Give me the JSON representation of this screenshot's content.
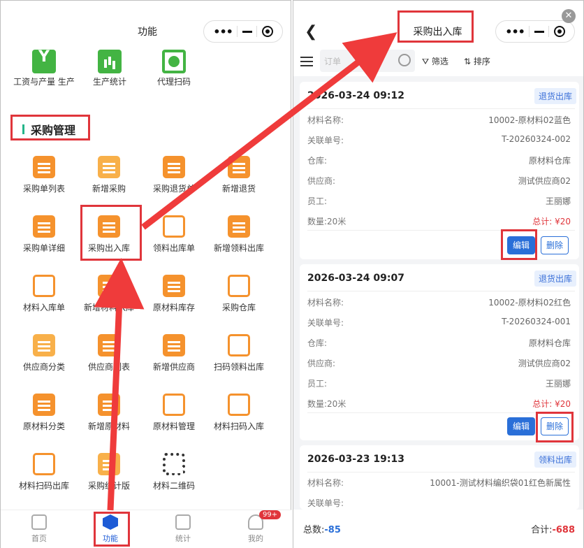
{
  "left": {
    "nav_title": "功能",
    "top_items": [
      {
        "label": "工资与产量 生产",
        "icon": "y-icon"
      },
      {
        "label": "生产统计",
        "icon": "chart-icon"
      },
      {
        "label": "代理扫码",
        "icon": "scan-icon"
      }
    ],
    "section_title": "采购管理",
    "grid": [
      "采购单列表",
      "新增采购",
      "采购退货单",
      "新增退货",
      "采购单详细",
      "采购出入库",
      "领料出库单",
      "新增领料出库",
      "材料入库单",
      "新增材料入库",
      "原材料库存",
      "采购仓库",
      "供应商分类",
      "供应商列表",
      "新增供应商",
      "扫码领料出库",
      "原材料分类",
      "新增原材料",
      "原材料管理",
      "材料扫码入库",
      "材料扫码出库",
      "采购统计版",
      "材料二维码"
    ],
    "tabs": [
      {
        "label": "首页"
      },
      {
        "label": "功能"
      },
      {
        "label": "统计"
      },
      {
        "label": "我的"
      }
    ],
    "badge": "99+"
  },
  "right": {
    "title": "采购出入库",
    "search_placeholder": "订单",
    "filter_label": "筛选",
    "sort_label": "排序",
    "field_labels": {
      "material": "材料名称:",
      "order": "关联单号:",
      "warehouse": "仓库:",
      "supplier": "供应商:",
      "staff": "员工:"
    },
    "cards": [
      {
        "time": "2026-03-24 09:12",
        "tag": "退货出库",
        "material": "10002-原材料02蓝色",
        "order": "T-20260324-002",
        "warehouse": "原材料仓库",
        "supplier": "测试供应商02",
        "staff": "王丽娜",
        "qty": "数量:20米",
        "total": "总计: ¥20",
        "edit": "编辑",
        "del": "删除"
      },
      {
        "time": "2026-03-24 09:07",
        "tag": "退货出库",
        "material": "10002-原材料02红色",
        "order": "T-20260324-001",
        "warehouse": "原材料仓库",
        "supplier": "测试供应商02",
        "staff": "王丽娜",
        "qty": "数量:20米",
        "total": "总计: ¥20",
        "edit": "编辑",
        "del": "删除"
      },
      {
        "time": "2026-03-23 19:13",
        "tag": "领料出库",
        "material": "10001-测试材料编织袋01红色新属性",
        "order": ""
      }
    ],
    "footer": {
      "count_label": "总数:",
      "count": "-85",
      "sum_label": "合计:",
      "sum": "-688"
    }
  }
}
